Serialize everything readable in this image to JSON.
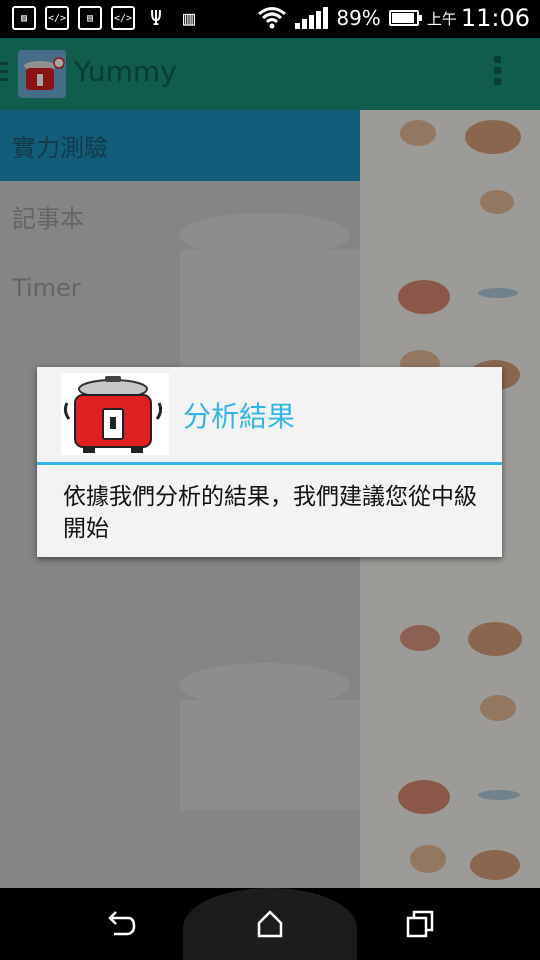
{
  "status_bar": {
    "battery": "89%",
    "time_prefix": "上午",
    "time": "11:06",
    "icons": [
      "image-icon",
      "code-icon",
      "picture-icon",
      "code-icon",
      "usb-icon",
      "barcode-icon",
      "wifi-icon",
      "signal-icon",
      "battery-charging-icon"
    ]
  },
  "app_bar": {
    "title": "Yummy",
    "icons": [
      "drawer-menu-icon",
      "rice-cooker-logo",
      "overflow-menu-icon"
    ]
  },
  "drawer": {
    "items": [
      {
        "label": "實力測驗",
        "selected": true
      },
      {
        "label": "記事本",
        "selected": false
      },
      {
        "label": "Timer",
        "selected": false
      }
    ]
  },
  "dialog": {
    "title": "分析結果",
    "message": "依據我們分析的結果，我們建議您從中級開始",
    "icon": "rice-cooker-icon",
    "accent_color": "#33b5e5"
  },
  "nav_bar": {
    "icons": [
      "back-icon",
      "home-icon",
      "recents-icon"
    ]
  },
  "colors": {
    "app_bar": "#1a8f79",
    "drawer_selected": "#1c90bc"
  }
}
